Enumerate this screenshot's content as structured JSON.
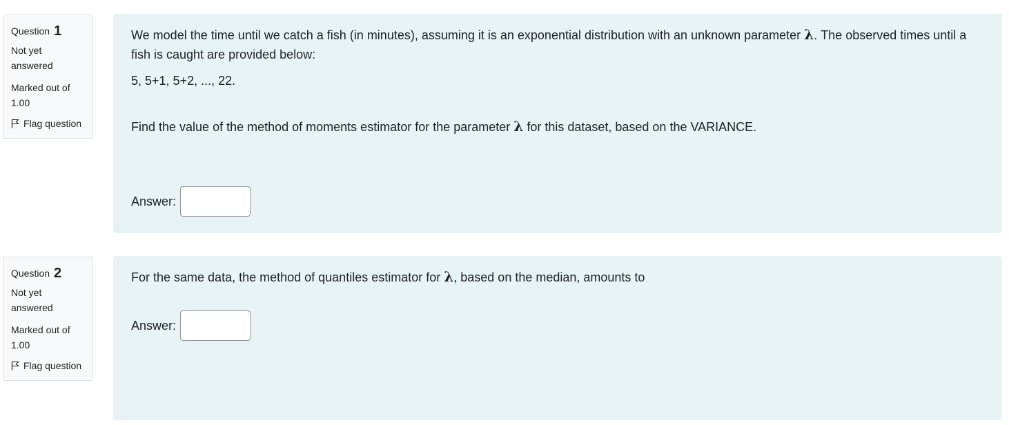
{
  "questions": [
    {
      "label": "Question",
      "number": "1",
      "state": "Not yet answered",
      "grade": "Marked out of 1.00",
      "flag_label": "Flag question",
      "text_intro_a": "We model the time until we catch a fish (in minutes), assuming it is an exponential distribution with an unknown parameter ",
      "lambda": "λ",
      "text_intro_b": ". The observed times until a fish is caught are provided below:",
      "data_line": "5, 5+1, 5+2, ..., 22.",
      "task_a": "Find the value of the method of moments estimator for the parameter ",
      "task_b": " for this dataset, based on the VARIANCE.",
      "answer_label": "Answer:",
      "answer_value": ""
    },
    {
      "label": "Question",
      "number": "2",
      "state": "Not yet answered",
      "grade": "Marked out of 1.00",
      "flag_label": "Flag question",
      "task_a": "For the same data, the method of quantiles estimator for ",
      "lambda": "λ",
      "task_b": ", based on the median, amounts to",
      "answer_label": "Answer:",
      "answer_value": ""
    }
  ],
  "colors": {
    "content_bg": "#e7f3f5",
    "info_bg": "#f8f9fa",
    "info_border": "#dee2e6",
    "text": "#1d2125"
  }
}
